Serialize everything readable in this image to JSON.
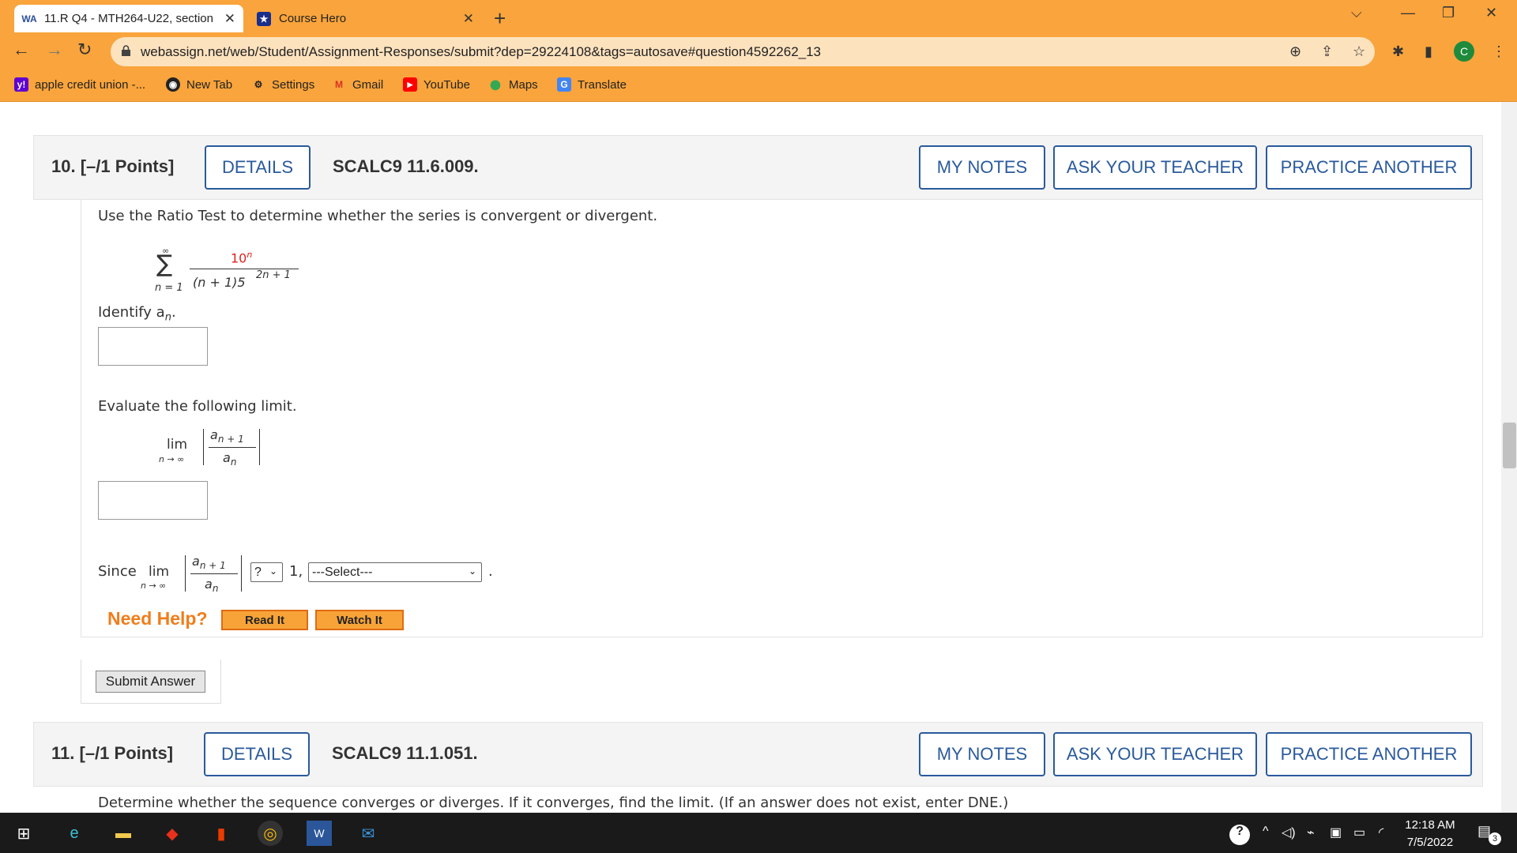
{
  "browser": {
    "tabs": [
      {
        "title": "11.R Q4 - MTH264-U22, section (",
        "favicon": "WA"
      },
      {
        "title": "Course Hero",
        "favicon": "star"
      }
    ],
    "url": "webassign.net/web/Student/Assignment-Responses/submit?dep=29224108&tags=autosave#question4592262_13",
    "profile_initial": "C",
    "bookmarks": [
      {
        "label": "apple credit union -...",
        "icon": "y!"
      },
      {
        "label": "New Tab",
        "icon": "globe"
      },
      {
        "label": "Settings",
        "icon": "gear"
      },
      {
        "label": "Gmail",
        "icon": "M"
      },
      {
        "label": "YouTube",
        "icon": "play"
      },
      {
        "label": "Maps",
        "icon": "pin"
      },
      {
        "label": "Translate",
        "icon": "G"
      }
    ]
  },
  "question10": {
    "number": "10.",
    "points": "[–/1 Points]",
    "details": "DETAILS",
    "code": "SCALC9 11.6.009.",
    "my_notes": "MY NOTES",
    "ask_teacher": "ASK YOUR TEACHER",
    "practice": "PRACTICE ANOTHER",
    "prompt": "Use the Ratio Test to determine whether the series is convergent or divergent.",
    "series": {
      "upper": "∞",
      "sigma": "∑",
      "lower": "n = 1",
      "numerator_base": "10",
      "numerator_exp": "n",
      "denominator": "(n + 1)5",
      "denominator_exp": "2n + 1"
    },
    "identify_label": "Identify a",
    "identify_sub": "n",
    "identify_end": ".",
    "evaluate_label": "Evaluate the following limit.",
    "lim": "lim",
    "lim_sub": "n → ∞",
    "frac_num": "a",
    "frac_num_sub": "n + 1",
    "frac_den": "a",
    "frac_den_sub": "n",
    "since": "Since",
    "compare_select": "?",
    "one": "1,",
    "conclusion_select": "---Select---",
    "period": ".",
    "need_help": "Need Help?",
    "read_it": "Read It",
    "watch_it": "Watch It",
    "submit": "Submit Answer"
  },
  "question11": {
    "number": "11.",
    "points": "[–/1 Points]",
    "details": "DETAILS",
    "code": "SCALC9 11.1.051.",
    "my_notes": "MY NOTES",
    "ask_teacher": "ASK YOUR TEACHER",
    "practice": "PRACTICE ANOTHER",
    "prompt": "Determine whether the sequence converges or diverges. If it converges, find the limit. (If an answer does not exist, enter DNE.)"
  },
  "taskbar": {
    "time": "12:18 AM",
    "date": "7/5/2022",
    "notifications": "3"
  },
  "colors": {
    "chrome_orange": "#f9a43c",
    "link_blue": "#2a5a9c",
    "need_help_orange": "#f07d1b",
    "math_red": "#e0201d"
  }
}
